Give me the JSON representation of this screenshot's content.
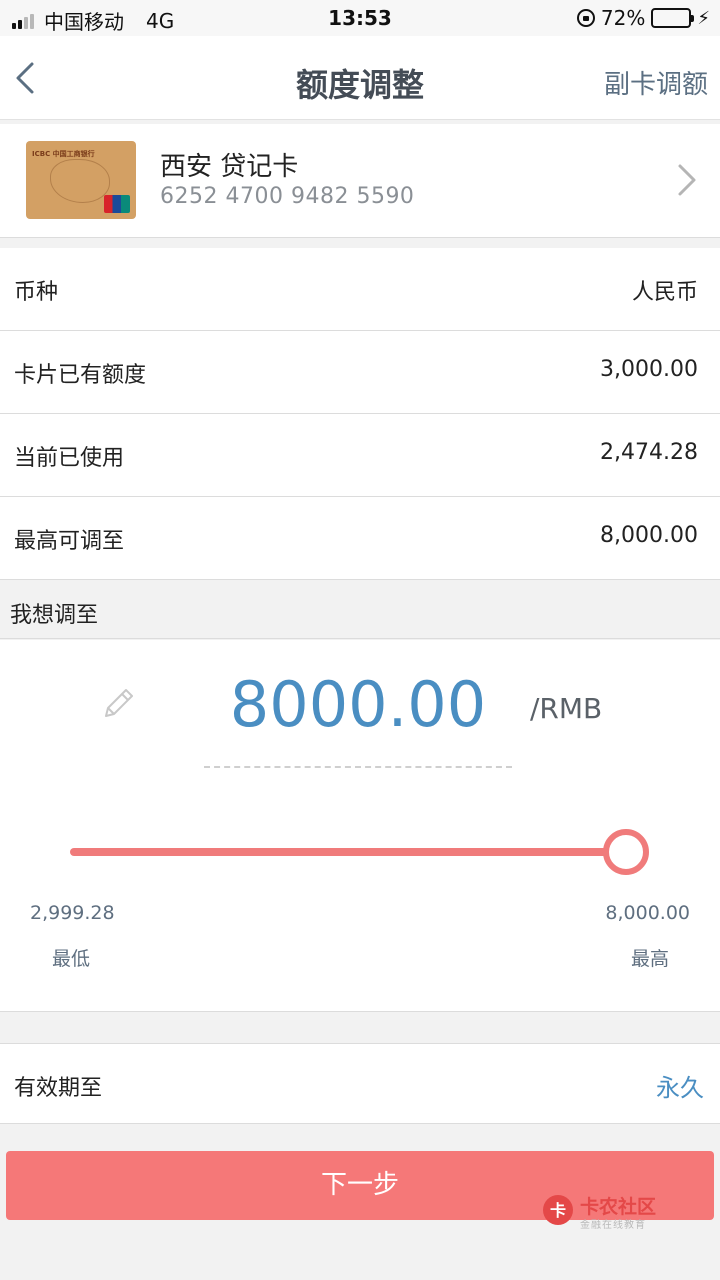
{
  "status_bar": {
    "carrier": "中国移动",
    "network": "4G",
    "time": "13:53",
    "battery_percent": "72%",
    "battery_level": 0.72
  },
  "nav": {
    "title": "额度调整",
    "right_label": "副卡调额"
  },
  "card": {
    "name": "西安 贷记卡",
    "number": "6252 4700 9482 5590",
    "image_bank_text": "ICBC 中国工商银行"
  },
  "info_rows": [
    {
      "label": "币种",
      "value": "人民币"
    },
    {
      "label": "卡片已有额度",
      "value": "3,000.00"
    },
    {
      "label": "当前已使用",
      "value": "2,474.28"
    },
    {
      "label": "最高可调至",
      "value": "8,000.00"
    }
  ],
  "adjust": {
    "section_label": "我想调至",
    "amount": "8000.00",
    "unit": "/RMB",
    "slider_fraction": 1.0,
    "min_value": "2,999.28",
    "min_label": "最低",
    "max_value": "8,000.00",
    "max_label": "最高"
  },
  "validity": {
    "label": "有效期至",
    "value": "永久"
  },
  "next_button": "下一步",
  "watermark": {
    "title": "卡农社区",
    "subtitle": "金融在线教育"
  },
  "colors": {
    "accent_blue": "#4a8ec2",
    "accent_red": "#f57878",
    "slider_red": "#f07b7b"
  }
}
